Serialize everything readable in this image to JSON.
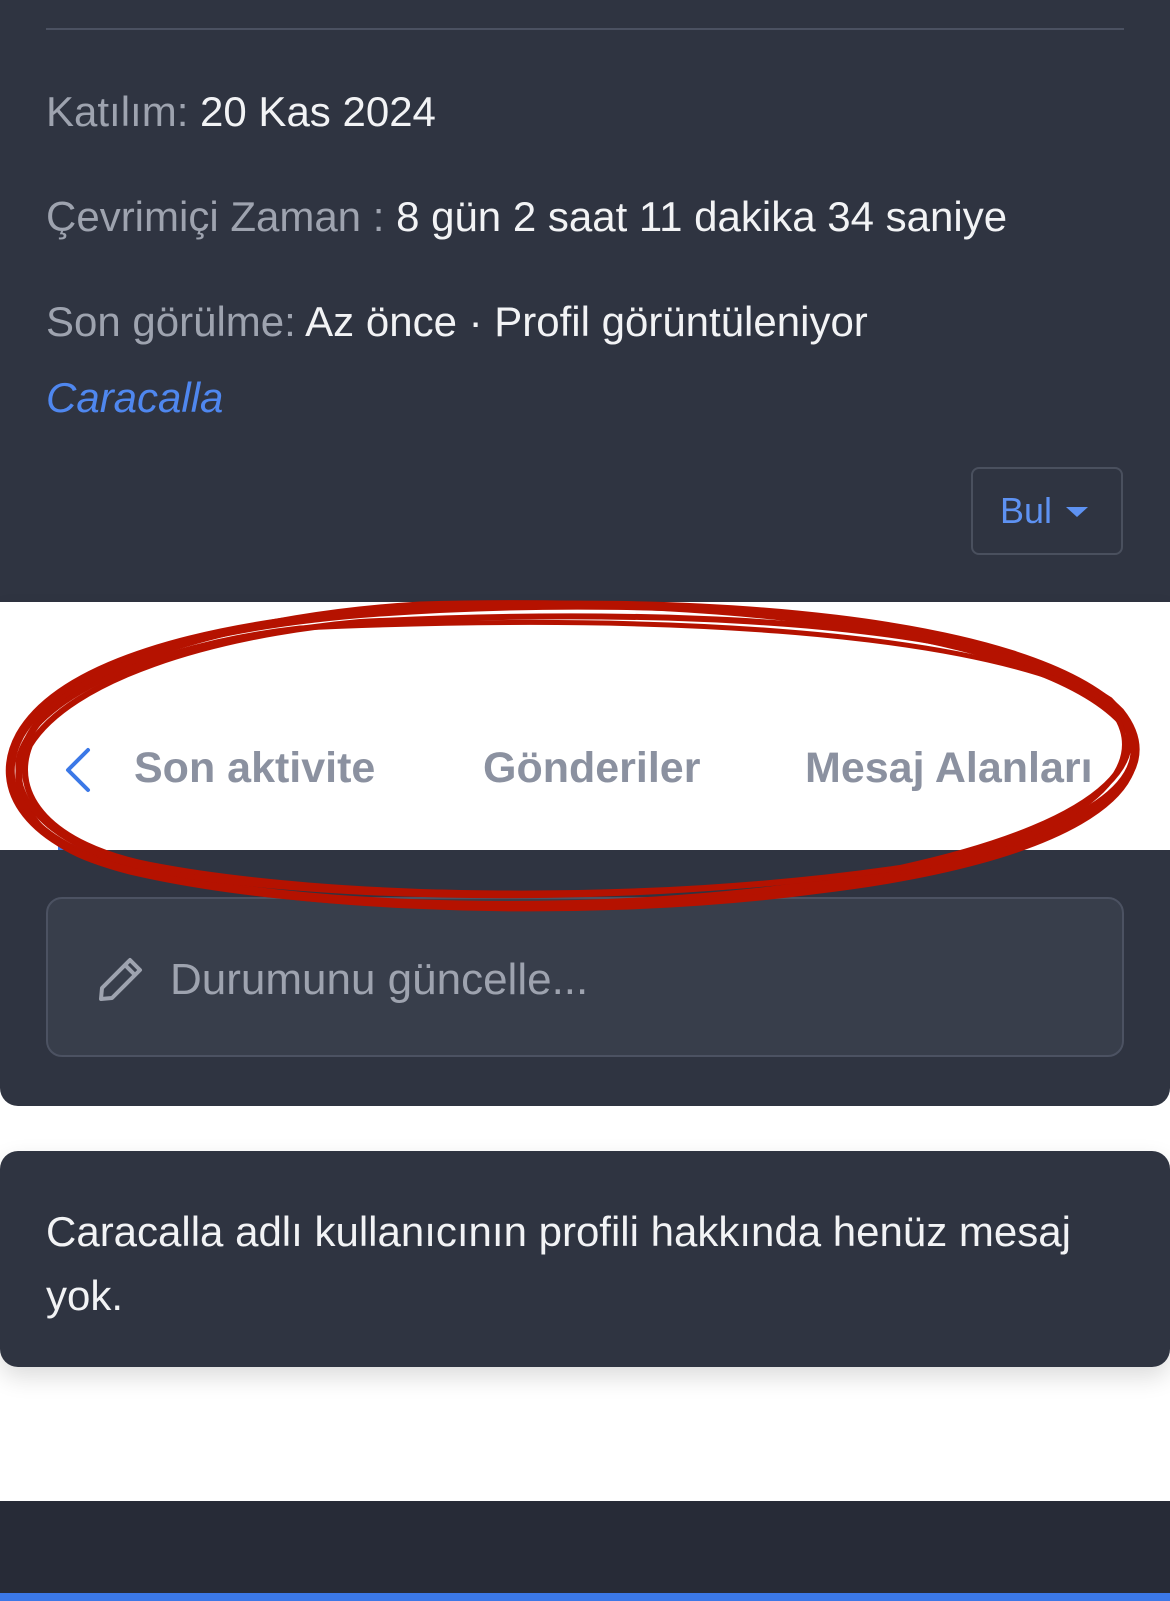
{
  "profile_info": {
    "joined": {
      "label": "Katılım:",
      "value": "20 Kas 2024"
    },
    "online_time": {
      "label": "Çevrimiçi Zaman :",
      "value": "8 gün 2 saat 11 dakika 34 saniye"
    },
    "last_seen": {
      "label": "Son görülme:",
      "value": "Az önce · Profil görüntüleniyor"
    },
    "last_seen_user": "Caracalla",
    "find_button": "Bul"
  },
  "tabs": {
    "items": [
      {
        "label": "Son aktivite"
      },
      {
        "label": "Gönderiler"
      },
      {
        "label": "Mesaj Alanları"
      }
    ]
  },
  "status": {
    "placeholder": "Durumunu güncelle..."
  },
  "messages": {
    "empty_text": "Caracalla adlı kullanıcının profili hakkında henüz mesaj yok."
  },
  "colors": {
    "panel": "#2f3441",
    "link": "#4f87ef",
    "accent": "#3b78e7",
    "annotation": "#b51200"
  },
  "icons": [
    "chevron-left-icon",
    "caret-down-icon",
    "pencil-icon"
  ]
}
